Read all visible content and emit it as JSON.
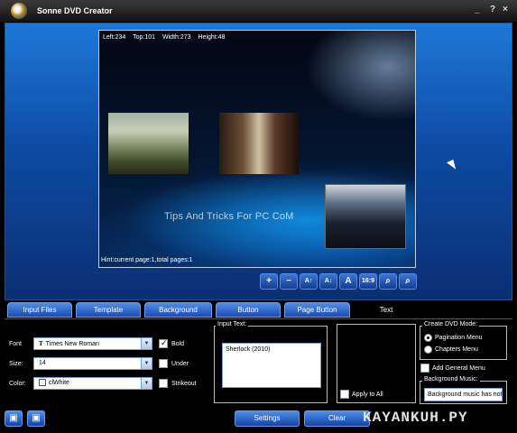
{
  "window": {
    "title": "Sonne DVD Creator",
    "minimize_glyph": "_",
    "help_glyph": "?",
    "close_glyph": "×"
  },
  "preview": {
    "left_label": "Left:234",
    "top_label": "Top:101",
    "width_label": "Width:273",
    "height_label": "Height:48",
    "watermark": "Tips And Tricks For PC CoM",
    "hint": "Hint:current page:1,total pages:1"
  },
  "toolbar": {
    "add_glyph": "+",
    "remove_glyph": "−",
    "font_up_glyph": "A↑",
    "font_down_glyph": "A↓",
    "text_color_glyph": "A",
    "aspect_label": "16:9",
    "zoom_in_glyph": "⌕",
    "zoom_out_glyph": "⌕"
  },
  "tabs": [
    "Input Files",
    "Template",
    "Background",
    "Button",
    "Page Button",
    "Text"
  ],
  "active_tab": "Text",
  "text_panel": {
    "font_label": "Font",
    "font_value": "Times New Roman",
    "font_glyph": "T",
    "size_label": "Size:",
    "size_value": "14",
    "color_label": "Color:",
    "color_value": "clWhite",
    "bold_label": "Bold",
    "under_label": "Under",
    "strikeout_label": "Strikeout",
    "bold_checked": true,
    "under_checked": false,
    "strikeout_checked": false,
    "input_text_title": "Input Text:",
    "input_text_value": "Sherlock (2010)",
    "apply_all_label": "Apply to All",
    "apply_all_checked": false
  },
  "dvd_mode": {
    "title": "Create DVD Mode:",
    "option_pagination": "Pagination Menu",
    "option_chapters": "Chapters Menu",
    "selected": "Pagination Menu",
    "add_general_menu_label": "Add General Menu",
    "add_general_menu_checked": false,
    "background_music_title": "Background Music:",
    "background_music_value": "Background music has not"
  },
  "bottom": {
    "settings_label": "Settings",
    "clear_label": "Clear",
    "left_icon1_glyph": "▣",
    "left_icon2_glyph": "▣"
  },
  "brand_watermark": "KAYANKUH.PY",
  "colors": {
    "accent": "#1b4cb0",
    "frame_top": "#1d78d8",
    "panel_bg": "#000000"
  }
}
